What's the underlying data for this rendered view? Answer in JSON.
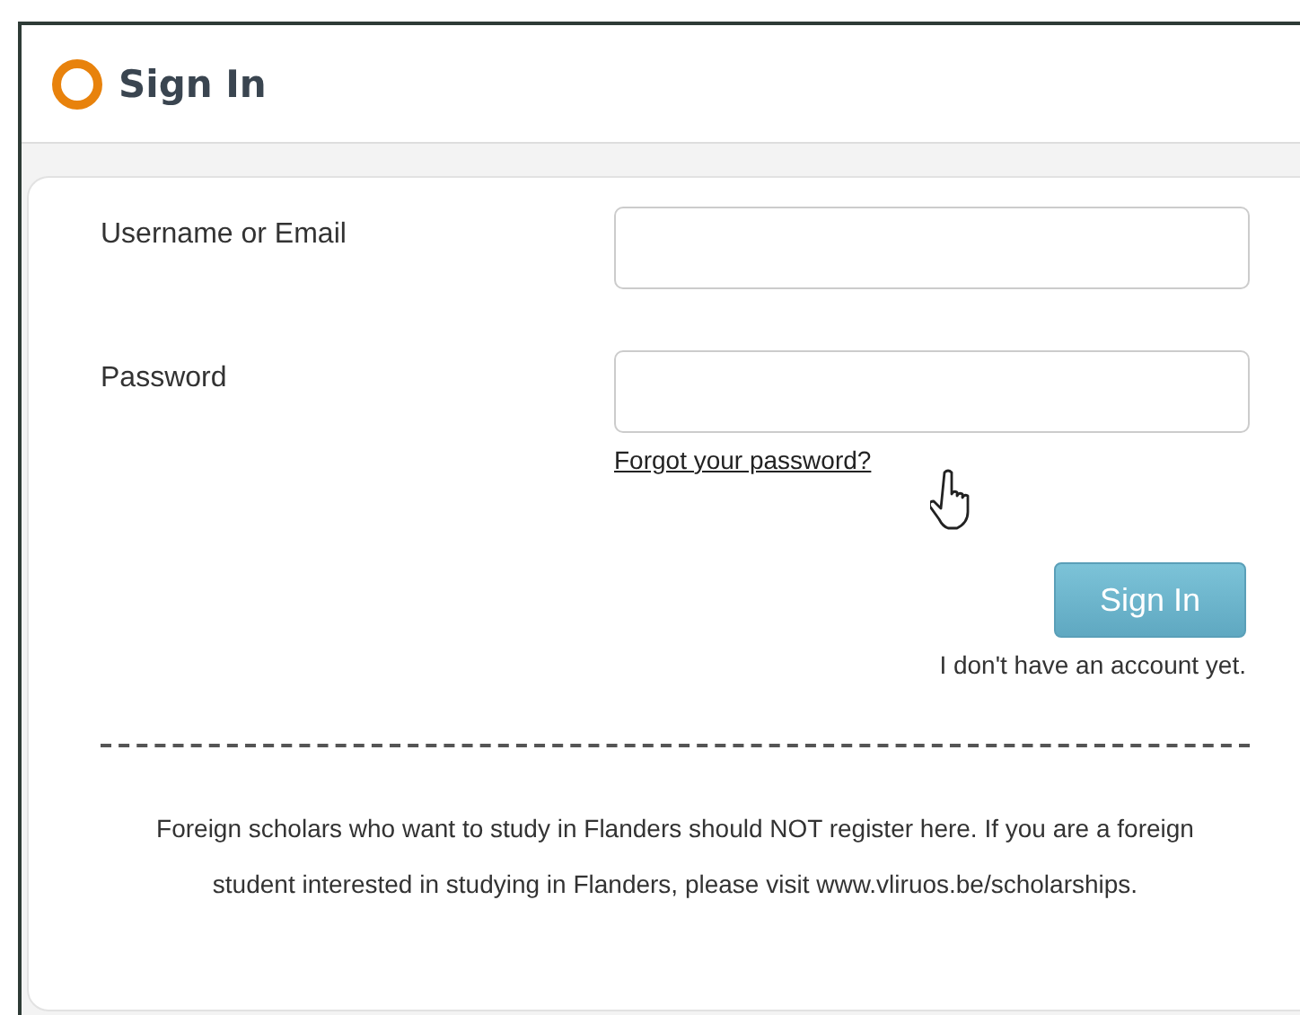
{
  "header": {
    "title": "Sign In"
  },
  "fields": [
    {
      "label": "Username or Email"
    },
    {
      "label": "Password"
    }
  ],
  "forgot_link": "Forgot your password?",
  "submit_button": "Sign In",
  "register_link": "I don't have an account yet.",
  "notice": "Foreign scholars who want to study in Flanders should NOT register here. If you are a foreign student interested in studying in Flanders, please visit www.vliruos.be/scholarships."
}
